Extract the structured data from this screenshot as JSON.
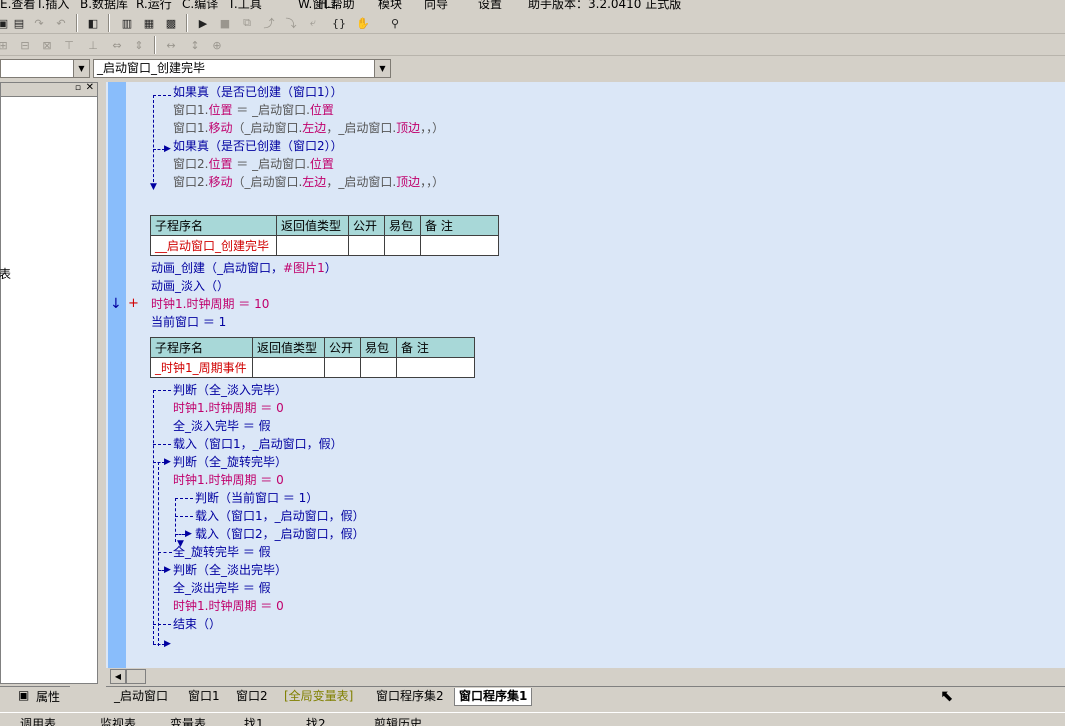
{
  "menu": [
    "E.查看",
    "I.插入",
    "B.数据库",
    "R.运行",
    "C.编译",
    "T.工具",
    "W.窗口",
    "H.帮助",
    "模块",
    "向导",
    "设置",
    "助手版本：3.2.0410 正式版"
  ],
  "combos": {
    "left": "",
    "right": "_启动窗口_创建完毕"
  },
  "left_panel": {
    "text": "表",
    "tab_label": "属性"
  },
  "code_lines": {
    "l1": "如果真（是否已创建（窗口1））",
    "l2a": "窗口1.",
    "l2b": "位置",
    "l2c": " ＝ _启动窗口.",
    "l2d": "位置",
    "l3a": "窗口1.",
    "l3b": "移动",
    "l3c": "（_启动窗口.",
    "l3d": "左边",
    "l3e": "，_启动窗口.",
    "l3f": "顶边",
    "l3g": "，，）",
    "l4": "如果真（是否已创建（窗口2））",
    "l5a": "窗口2.",
    "l5b": "位置",
    "l5c": " ＝ _启动窗口.",
    "l5d": "位置",
    "l6a": "窗口2.",
    "l6b": "移动",
    "l6c": "（_启动窗口.",
    "l6d": "左边",
    "l6e": "，_启动窗口.",
    "l6f": "顶边",
    "l6g": "，，）",
    "l7a": "动画_创建（_启动窗口，",
    "l7b": "#图片1",
    "l7c": "）",
    "l8": "动画_淡入（）",
    "l9": "时钟1.时钟周期 ＝ 10",
    "l10": "当前窗口 ＝ 1",
    "m1": "判断（全_淡入完毕）",
    "m2": "时钟1.时钟周期 ＝ 0",
    "m3": "全_淡入完毕 ＝ 假",
    "m4": "载入（窗口1，_启动窗口，假）",
    "m5": "判断（全_旋转完毕）",
    "m6": "时钟1.时钟周期 ＝ 0",
    "m7": "判断（当前窗口 ＝ 1）",
    "m8": "载入（窗口1，_启动窗口，假）",
    "m9": "载入（窗口2，_启动窗口，假）",
    "m10": "全_旋转完毕 ＝ 假",
    "m11": "判断（全_淡出完毕）",
    "m12": "全_淡出完毕 ＝ 假",
    "m13": "时钟1.时钟周期 ＝ 0",
    "m14": "结束（）"
  },
  "table_headers": [
    "子程序名",
    "返回值类型",
    "公开",
    "易包",
    "备 注"
  ],
  "sub1_name": "__启动窗口_创建完毕",
  "sub2_name": "_时钟1_周期事件",
  "gutter_marks": {
    "arrow": "↓",
    "plus": "+"
  },
  "tabs": [
    "_启动窗口",
    "窗口1",
    "窗口2",
    "[全局变量表]",
    "窗口程序集2",
    "窗口程序集1"
  ],
  "status": [
    "调用表",
    "监视表",
    "变量表",
    "找1",
    "找2",
    "剪辑历史"
  ],
  "colors": {
    "editor_bg": "#dbe7f7",
    "gutter": "#89bdfb",
    "keyword": "#0000a0",
    "member": "#c0006c",
    "table_header": "#a8d8d8"
  }
}
